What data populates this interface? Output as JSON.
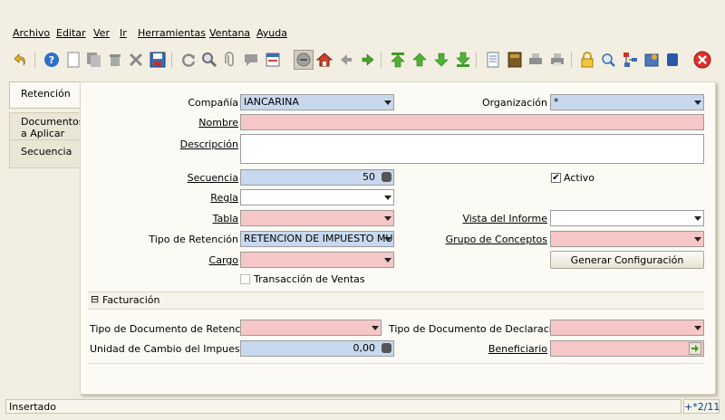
{
  "menu": [
    "Archivo",
    "Editar",
    "Ver",
    "Ir",
    "Herramientas",
    "Ventana",
    "Ayuda"
  ],
  "tabs": [
    "Retención",
    "Documentos a Aplicar",
    "Secuencia"
  ],
  "form": {
    "compania_label": "Compañía",
    "compania_value": "IANCARINA",
    "organizacion_label": "Organización",
    "organizacion_value": "*",
    "nombre_label": "Nombre",
    "nombre_value": "",
    "descripcion_label": "Descripción",
    "descripcion_value": "",
    "secuencia_label": "Secuencia",
    "secuencia_value": "50",
    "activo_label": "Activo",
    "activo_checked": "✔",
    "regla_label": "Regla",
    "regla_value": "",
    "tabla_label": "Tabla",
    "tabla_value": "",
    "vista_label": "Vista del Informe",
    "vista_value": "",
    "tipo_ret_label": "Tipo de Retención",
    "tipo_ret_value": "RETENCION DE IMPUESTO MUN",
    "grupo_label": "Grupo de Conceptos",
    "grupo_value": "",
    "cargo_label": "Cargo",
    "cargo_value": "",
    "generar_btn": "Generar Configuración",
    "trans_ventas_label": "Transacción de Ventas"
  },
  "facturacion": {
    "header": "Facturación",
    "toggle": "⊟",
    "tipo_doc_ret_label": "Tipo de Documento de Retencion",
    "tipo_doc_ret_value": "",
    "tipo_doc_decl_label": "Tipo de Documento de Declaracion",
    "tipo_doc_decl_value": "",
    "unidad_label": "Unidad de Cambio del Impuesto",
    "unidad_value": "0,00",
    "beneficiario_label": "Beneficiario",
    "beneficiario_value": ""
  },
  "status": {
    "text": "Insertado",
    "page": "+*2/11"
  }
}
